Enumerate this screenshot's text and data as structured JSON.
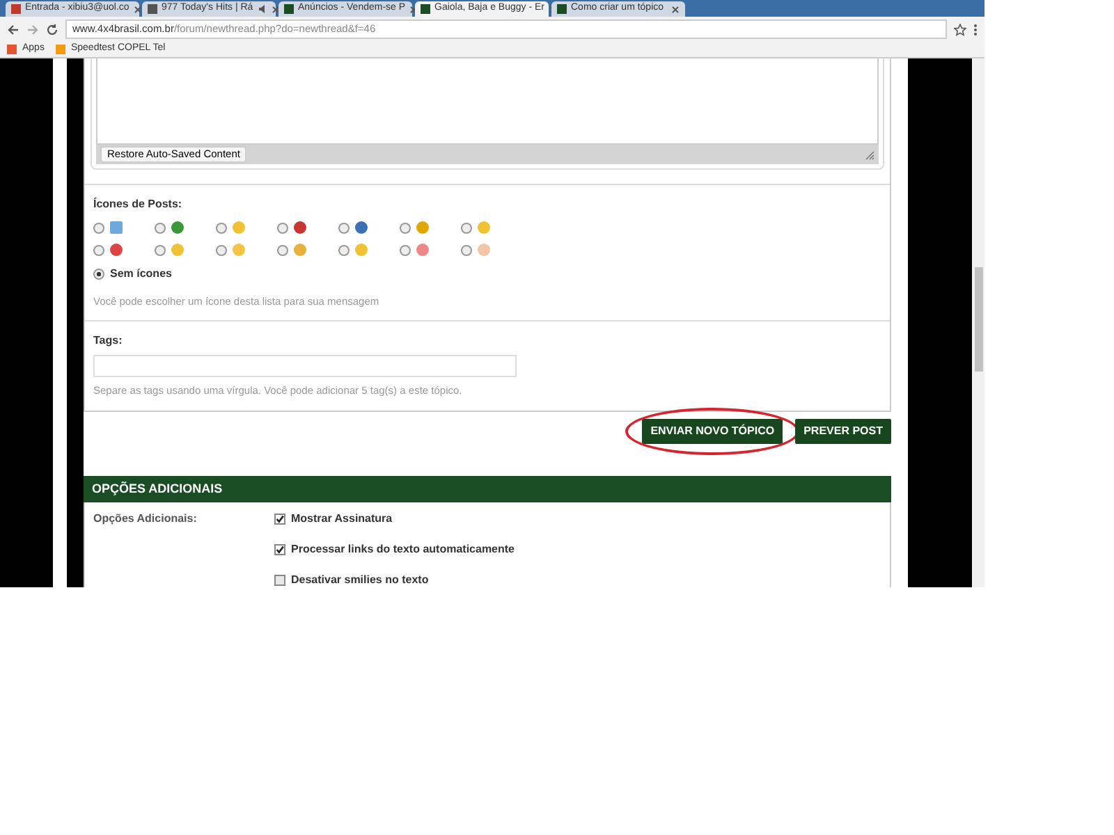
{
  "browser": {
    "tabs": [
      {
        "title": "Entrada - xibiu3@uol.co",
        "kind": "mail",
        "audio": false,
        "selected": false
      },
      {
        "title": "977 Today's Hits | Rá",
        "kind": "radio",
        "audio": true,
        "selected": false
      },
      {
        "title": "Anúncios - Vendem-se P",
        "kind": "site",
        "audio": false,
        "selected": false
      },
      {
        "title": "Gaiola, Baja e Buggy - Er",
        "kind": "site",
        "audio": false,
        "selected": true
      },
      {
        "title": "Como criar um tópico",
        "kind": "site",
        "audio": false,
        "selected": false
      }
    ],
    "address": {
      "host": "www.4x4brasil.com.br",
      "path": "/forum/newthread.php?do=newthread&f=46"
    },
    "bookmarks": [
      {
        "label": "Apps",
        "kind": "apps"
      },
      {
        "label": "Speedtest COPEL Tel",
        "kind": "site"
      }
    ]
  },
  "editor": {
    "restore_button": "Restore Auto-Saved Content"
  },
  "post_icons": {
    "label": "Ícones de Posts:",
    "icons": [
      {
        "selected": false
      },
      {
        "selected": false
      },
      {
        "selected": false
      },
      {
        "selected": false
      },
      {
        "selected": false
      },
      {
        "selected": false
      },
      {
        "selected": false
      },
      {
        "selected": false
      },
      {
        "selected": false
      },
      {
        "selected": false
      },
      {
        "selected": false
      },
      {
        "selected": false
      },
      {
        "selected": false
      },
      {
        "selected": false
      }
    ],
    "none_option": {
      "label": "Sem ícones",
      "selected": true
    },
    "hint": "Você pode escolher um ícone desta lista para sua mensagem"
  },
  "tags": {
    "label": "Tags:",
    "hint": "Separe as tags usando uma vírgula. Você pode adicionar 5 tag(s) a este tópico."
  },
  "buttons": [
    {
      "label": "ENVIAR NOVO TÓPICO",
      "highlighted": true
    },
    {
      "label": "PREVER POST",
      "highlighted": false
    }
  ],
  "additional_options": {
    "header": "OPÇÕES ADICIONAIS",
    "label": "Opções Adicionais:",
    "options": [
      {
        "label": "Mostrar Assinatura",
        "checked": true
      },
      {
        "label": "Processar links do texto automaticamente",
        "checked": true
      },
      {
        "label": "Desativar smilies no texto",
        "checked": false
      }
    ]
  }
}
